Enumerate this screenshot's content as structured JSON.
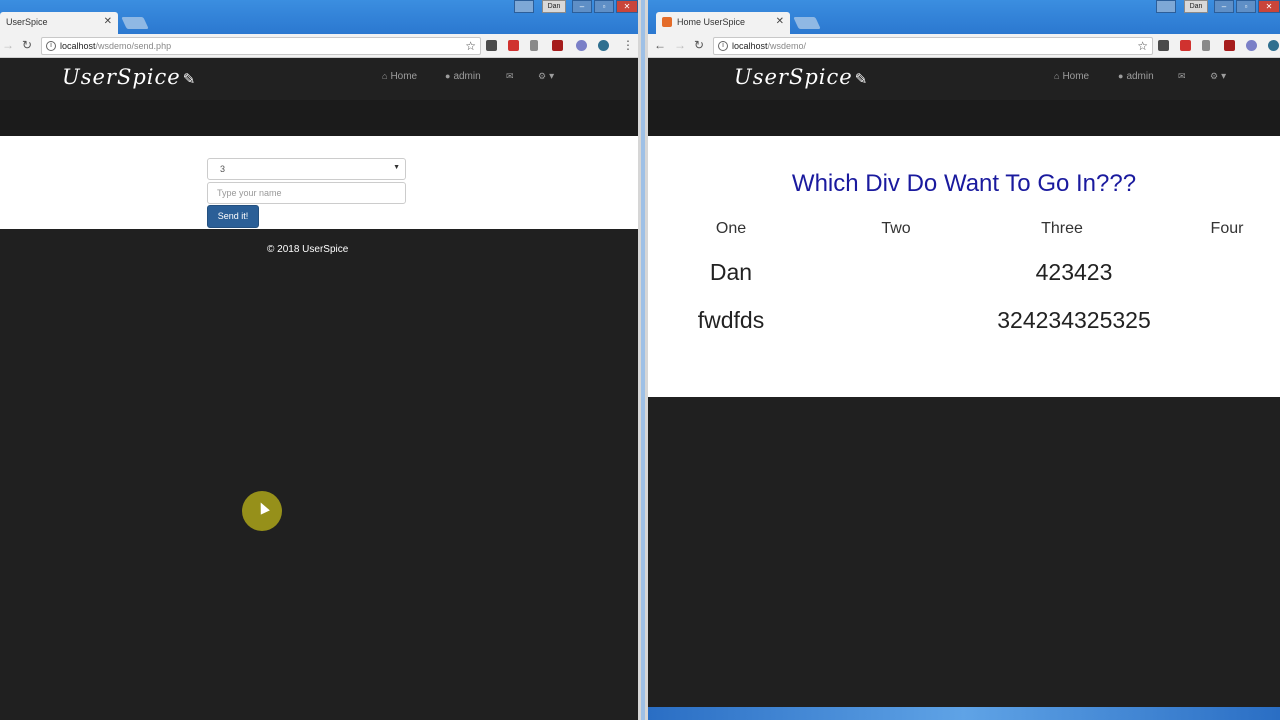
{
  "left": {
    "tab": {
      "title": "UserSpice"
    },
    "address": {
      "host": "localhost",
      "path": "/wsdemo/send.php"
    },
    "brand": "UserSpice",
    "nav": {
      "home": "Home",
      "admin": "admin"
    },
    "form": {
      "select_value": "3",
      "name_placeholder": "Type your name",
      "send_label": "Send it!"
    },
    "footer": "© 2018 UserSpice"
  },
  "right": {
    "tab": {
      "title": "Home UserSpice"
    },
    "address": {
      "host": "localhost",
      "path": "/wsdemo/"
    },
    "brand": "UserSpice",
    "nav": {
      "home": "Home",
      "admin": "admin"
    },
    "title": "Which Div Do Want To Go In???",
    "columns": [
      "One",
      "Two",
      "Three",
      "Four"
    ],
    "rows": [
      {
        "one": "Dan",
        "three": "423423"
      },
      {
        "one": "fwdfds",
        "three": "324234325325"
      }
    ]
  },
  "window_user": "Dan",
  "colors": {
    "accent": "#2b5f97",
    "title": "#1a1a9e",
    "navbar": "#212121"
  }
}
